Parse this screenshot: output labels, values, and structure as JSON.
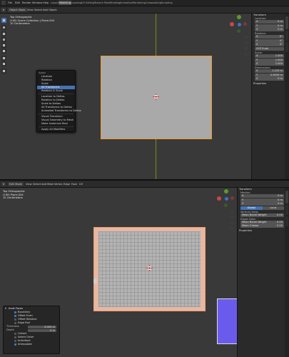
{
  "menubar": {
    "menus": [
      "File",
      "Edit",
      "Render",
      "Window",
      "Help"
    ],
    "workspaces": [
      "Layout",
      "Modeling",
      "Sculpting",
      "UV Editing",
      "Texture Paint",
      "Shading",
      "Animation",
      "Rendering",
      "Compositing",
      "Scripting"
    ],
    "active_workspace": "Modeling"
  },
  "top_view": {
    "header": {
      "mode": "Object Mode",
      "menus": [
        "View",
        "Select",
        "Add",
        "Object"
      ]
    },
    "stats": [
      "Top Orthographic",
      "(100) Scene Collection | Plane.004",
      "10 Centimeters"
    ],
    "context_menu": {
      "title": "Apply",
      "items": [
        "Location",
        "Rotation",
        "Scale",
        "All Transforms",
        "Rotation & Scale",
        "Location to Deltas",
        "Rotation to Deltas",
        "Scale to Deltas",
        "All Transforms to Deltas",
        "Animated Transforms to Deltas",
        "Visual Transform",
        "Visual Geometry to Mesh",
        "Make Instances Real",
        "Apply All Modifiers"
      ],
      "highlighted": "All Transforms"
    },
    "npanel": {
      "section": "Transform",
      "location_label": "Location:",
      "location": [
        {
          "k": "X",
          "v": "0 m"
        },
        {
          "k": "Y",
          "v": "0 m"
        },
        {
          "k": "Z",
          "v": "0 m"
        }
      ],
      "rotation_label": "Rotation:",
      "rotation": [
        {
          "k": "X",
          "v": "0°"
        },
        {
          "k": "Y",
          "v": "0°"
        },
        {
          "k": "Z",
          "v": "0°"
        }
      ],
      "rotation_mode": "XYZ Euler",
      "scale_label": "Scale:",
      "scale": [
        {
          "k": "X",
          "v": "1.000"
        },
        {
          "k": "Y",
          "v": "1.000"
        },
        {
          "k": "Z",
          "v": "1.000"
        }
      ],
      "dimensions_label": "Dimensions:",
      "dimensions": [
        {
          "k": "X",
          "v": "1.125 m"
        },
        {
          "k": "Y",
          "v": "0.9039 m"
        },
        {
          "k": "Z",
          "v": "0 m"
        }
      ],
      "properties_label": "Properties"
    }
  },
  "bottom_view": {
    "header": {
      "mode": "Edit Mode",
      "menus": [
        "View",
        "Select",
        "Add",
        "Mesh",
        "Vertex",
        "Edge",
        "Face",
        "UV"
      ]
    },
    "stats": [
      "Top Orthographic",
      "(100) Plane.004",
      "10 Centimeters"
    ],
    "npanel": {
      "section": "Transform",
      "median_label": "Median:",
      "median": [
        {
          "k": "X",
          "v": "0 m"
        },
        {
          "k": "Y",
          "v": "0 m"
        },
        {
          "k": "Z",
          "v": "0 m"
        }
      ],
      "space_buttons": [
        "Global",
        "Local"
      ],
      "vertices_data_label": "Vertices Data:",
      "vertices_data": [
        {
          "k": "Mean Bevel Weight",
          "v": "0.00"
        }
      ],
      "edges_data_label": "Edges Data:",
      "edges_data": [
        {
          "k": "Mean Bevel Weight",
          "v": "0.00"
        },
        {
          "k": "Mean Crease",
          "v": "0.00"
        }
      ],
      "properties_label": "Properties"
    },
    "op_panel": {
      "title": "Inset Faces",
      "rows": [
        {
          "type": "check",
          "label": "Boundary",
          "on": true
        },
        {
          "type": "check",
          "label": "Offset Even",
          "on": true
        },
        {
          "type": "check",
          "label": "Offset Relative",
          "on": false
        },
        {
          "type": "check",
          "label": "Edge Rail",
          "on": false
        },
        {
          "type": "field",
          "label": "Thickness",
          "value": "0.005 m"
        },
        {
          "type": "field",
          "label": "Depth",
          "value": "0 m"
        },
        {
          "type": "check",
          "label": "Outset",
          "on": false
        },
        {
          "type": "check",
          "label": "Select Outer",
          "on": false
        },
        {
          "type": "check",
          "label": "Individual",
          "on": false
        },
        {
          "type": "check",
          "label": "Interpolate",
          "on": true
        }
      ]
    }
  },
  "colors": {
    "selection_orange": "#f09a2a",
    "accent_blue": "#4772b3",
    "camera_preview": "#6b5bed"
  }
}
